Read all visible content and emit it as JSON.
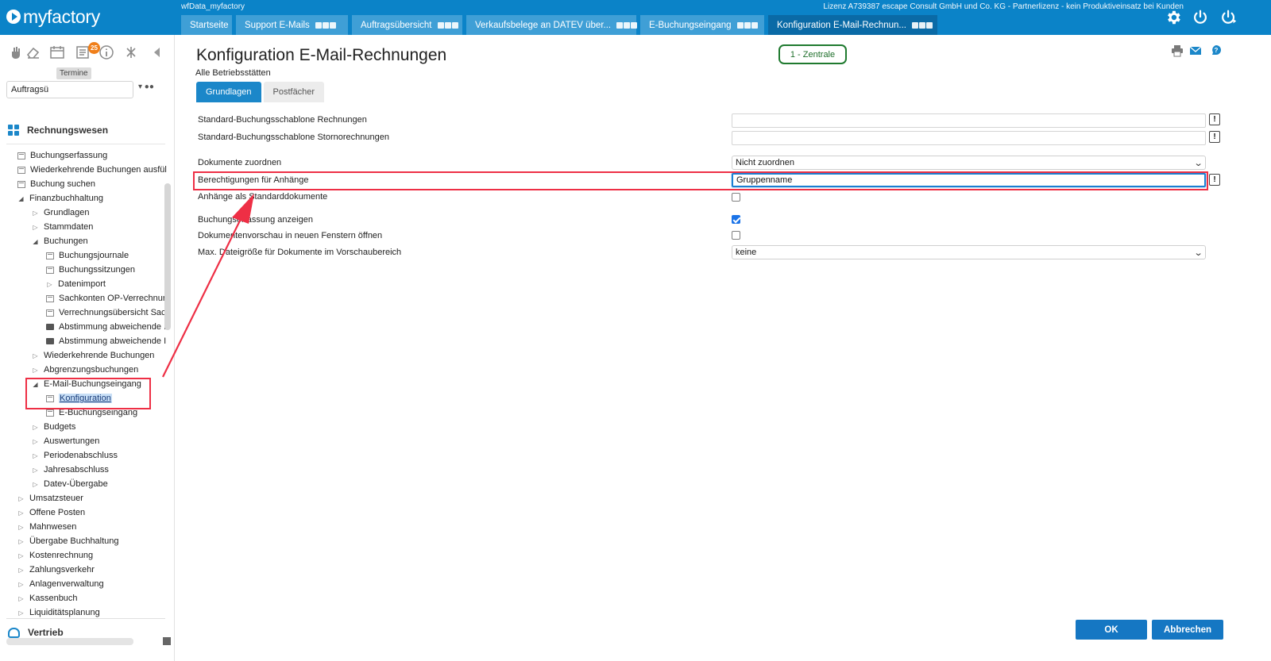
{
  "app": {
    "logo_text": "myfactory",
    "database": "wfData_myfactory",
    "license": "Lizenz A739387 escape Consult GmbH und Co. KG - Partnerlizenz - kein Produktiveinsatz bei Kunden"
  },
  "tabs": [
    {
      "label": "Startseite"
    },
    {
      "label": "Support E-Mails"
    },
    {
      "label": "Auftragsübersicht"
    },
    {
      "label": "Verkaufsbelege an DATEV über..."
    },
    {
      "label": "E-Buchungseingang"
    },
    {
      "label": "Konfiguration E-Mail-Rechnun..."
    }
  ],
  "topbar_icons": [
    "settings-gear-icon",
    "power-icon",
    "logout-power-icon"
  ],
  "sidebar": {
    "tools": [
      "hand-icon",
      "eraser-icon",
      "calendar-icon",
      "list-icon",
      "info-icon",
      "pin-icon",
      "collapse-left-icon"
    ],
    "badge": "25",
    "tooltip": "Termine",
    "search_value": "Auftragsü",
    "module": "Rechnungswesen",
    "tree": [
      {
        "label": "Buchungserfassung",
        "icon": "page",
        "level": 1
      },
      {
        "label": "Wiederkehrende Buchungen ausfül",
        "icon": "page",
        "level": 1
      },
      {
        "label": "Buchung suchen",
        "icon": "page",
        "level": 1
      },
      {
        "label": "Finanzbuchhaltung",
        "icon": "open",
        "level": 1
      },
      {
        "label": "Grundlagen",
        "icon": "closed",
        "level": 2
      },
      {
        "label": "Stammdaten",
        "icon": "closed",
        "level": 2
      },
      {
        "label": "Buchungen",
        "icon": "open",
        "level": 2
      },
      {
        "label": "Buchungsjournale",
        "icon": "page",
        "level": 3
      },
      {
        "label": "Buchungssitzungen",
        "icon": "page",
        "level": 3
      },
      {
        "label": "Datenimport",
        "icon": "closed",
        "level": 3
      },
      {
        "label": "Sachkonten OP-Verrechnun",
        "icon": "page",
        "level": 3
      },
      {
        "label": "Verrechnungsübersicht Sac",
        "icon": "page",
        "level": 3
      },
      {
        "label": "Abstimmung abweichende I",
        "icon": "print",
        "level": 3
      },
      {
        "label": "Abstimmung abweichende I",
        "icon": "print",
        "level": 3
      },
      {
        "label": "Wiederkehrende Buchungen",
        "icon": "closed",
        "level": 2
      },
      {
        "label": "Abgrenzungsbuchungen",
        "icon": "closed",
        "level": 2
      },
      {
        "label": "E-Mail-Buchungseingang",
        "icon": "open",
        "level": 2
      },
      {
        "label": "Konfiguration",
        "icon": "page",
        "level": 3,
        "selected": true
      },
      {
        "label": "E-Buchungseingang",
        "icon": "page",
        "level": 3
      },
      {
        "label": "Budgets",
        "icon": "closed",
        "level": 2
      },
      {
        "label": "Auswertungen",
        "icon": "closed",
        "level": 2
      },
      {
        "label": "Periodenabschluss",
        "icon": "closed",
        "level": 2
      },
      {
        "label": "Jahresabschluss",
        "icon": "closed",
        "level": 2
      },
      {
        "label": "Datev-Übergabe",
        "icon": "closed",
        "level": 2
      },
      {
        "label": "Umsatzsteuer",
        "icon": "closed",
        "level": 1
      },
      {
        "label": "Offene Posten",
        "icon": "closed",
        "level": 1
      },
      {
        "label": "Mahnwesen",
        "icon": "closed",
        "level": 1
      },
      {
        "label": "Übergabe Buchhaltung",
        "icon": "closed",
        "level": 1
      },
      {
        "label": "Kostenrechnung",
        "icon": "closed",
        "level": 1
      },
      {
        "label": "Zahlungsverkehr",
        "icon": "closed",
        "level": 1
      },
      {
        "label": "Anlagenverwaltung",
        "icon": "closed",
        "level": 1
      },
      {
        "label": "Kassenbuch",
        "icon": "closed",
        "level": 1
      },
      {
        "label": "Liquiditätsplanung",
        "icon": "closed",
        "level": 1
      }
    ],
    "footer_module": "Vertrieb"
  },
  "main": {
    "title": "Konfiguration E-Mail-Rechnungen",
    "subtitle": "Alle Betriebsstätten",
    "branch": "1 - Zentrale",
    "header_icons": [
      "print-icon",
      "mail-icon",
      "help-icon"
    ],
    "subtabs": [
      "Grundlagen",
      "Postfächer"
    ],
    "fields": {
      "template_invoices": {
        "label": "Standard-Buchungsschablone Rechnungen",
        "value": ""
      },
      "template_credit": {
        "label": "Standard-Buchungsschablone Stornorechnungen",
        "value": ""
      },
      "assign_documents": {
        "label": "Dokumente zuordnen",
        "value": "Nicht zuordnen"
      },
      "attachment_permissions": {
        "label": "Berechtigungen für Anhänge",
        "value": "Gruppenname"
      },
      "attachments_default_docs": {
        "label": "Anhänge als Standarddokumente",
        "checked": false
      },
      "show_booking_entry": {
        "label": "Buchungserfassung anzeigen",
        "checked": true
      },
      "preview_new_window": {
        "label": "Dokumentenvorschau in neuen Fenstern öffnen",
        "checked": false
      },
      "max_filesize": {
        "label": "Max. Dateigröße für Dokumente im Vorschaubereich",
        "value": "keine"
      }
    },
    "ok": "OK",
    "cancel": "Abbrechen"
  },
  "info_button_glyph": "!",
  "colors": {
    "topbar": "#0b83c8",
    "accent": "#1b87c9",
    "annotation": "#ee2f45",
    "branch": "#1f7a2f",
    "badge": "#f07f1a"
  }
}
